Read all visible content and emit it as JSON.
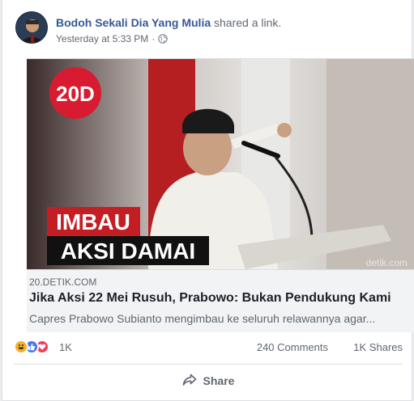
{
  "post": {
    "author": "Bodoh Sekali Dia Yang Mulia",
    "action": "shared a link.",
    "timestamp": "Yesterday at 5:33 PM",
    "separator": "·",
    "privacy_icon": "globe-icon"
  },
  "link": {
    "image_logo_text": "20D",
    "image_caption_line1": "IMBAU",
    "image_caption_line2": "AKSI DAMAI",
    "image_watermark": "detik.com",
    "domain": "20.DETIK.COM",
    "title": "Jika Aksi 22 Mei Rusuh, Prabowo: Bukan Pendukung Kami",
    "description": "Capres Prabowo Subianto mengimbau ke seluruh relawannya agar..."
  },
  "stats": {
    "reactions": [
      "haha-icon",
      "like-icon",
      "love-icon"
    ],
    "reaction_count": "1K",
    "comments": "240 Comments",
    "shares": "1K Shares"
  },
  "actions": {
    "share_label": "Share"
  },
  "colors": {
    "author": "#365899",
    "like": "#4a76f0",
    "love": "#f33e58",
    "haha": "#f7b125"
  }
}
